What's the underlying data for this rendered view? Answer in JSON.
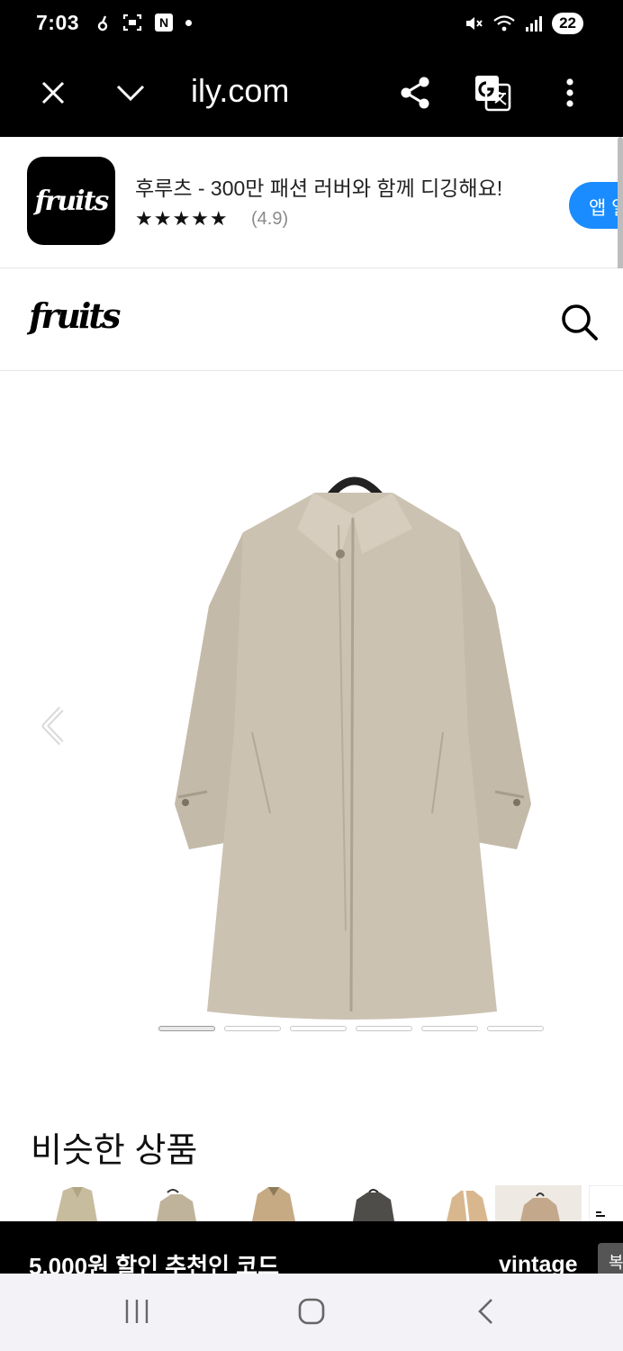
{
  "status_bar": {
    "time": "7:03",
    "notification_n": "N",
    "battery": "22"
  },
  "browser": {
    "url": "ily.com",
    "icons": [
      "close-icon",
      "chevron-down-icon",
      "share-icon",
      "translate-icon",
      "more-vert-icon"
    ]
  },
  "app_banner": {
    "title": "후루츠 - 300만 패션 러버와 함께 디깅해요!",
    "stars": "★★★★★",
    "rating": "(4.9)",
    "open_button": "앱 열",
    "icon_text": "fruits",
    "button_color": "#1a8cff"
  },
  "site_header": {
    "logo": "fruits",
    "icons": [
      "search-icon"
    ]
  },
  "carousel": {
    "image_count": 6,
    "active_index": 0,
    "item_color": "#c9bfae"
  },
  "similar": {
    "title": "비슷한 상품",
    "thumbnail_count": 8
  },
  "promo": {
    "text": "5,000원 할인 추천인 코드",
    "code": "vintage",
    "button": "복"
  },
  "nav": {
    "icons": [
      "recents-icon",
      "home-icon",
      "back-icon"
    ]
  }
}
